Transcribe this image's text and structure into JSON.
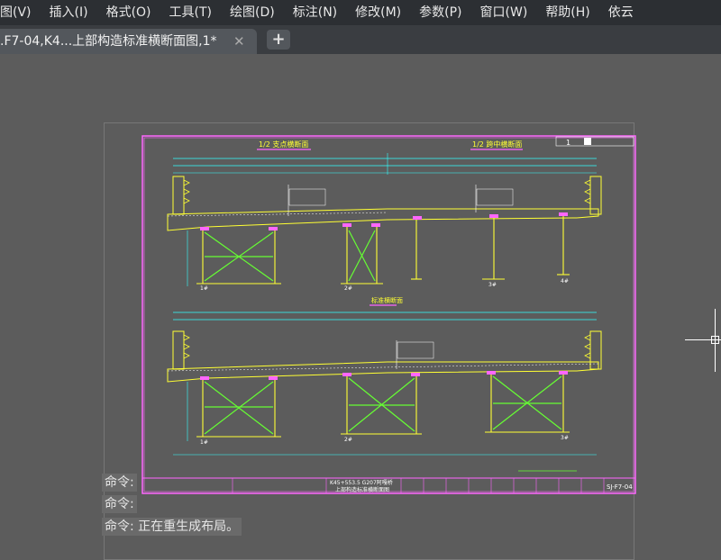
{
  "menu": {
    "items": [
      "图(V)",
      "插入(I)",
      "格式(O)",
      "工具(T)",
      "绘图(D)",
      "标注(N)",
      "修改(M)",
      "参数(P)",
      "窗口(W)",
      "帮助(H)",
      "依云"
    ]
  },
  "tabs": {
    "active_title": ".F7-04,K4...上部构造标准横断面图,1*",
    "close_glyph": "✕",
    "add_glyph": "+"
  },
  "drawing": {
    "top_left_title": "1/2 支点横断面",
    "top_right_title": "1/2 跨中横断面",
    "bottom_title": "标准横断面",
    "pier_labels_top": [
      "1#",
      "2#",
      "3#",
      "4#"
    ],
    "pier_labels_bottom": [
      "1#",
      "2#",
      "3#"
    ],
    "title_block_main": "K45+553.5 G207阿嘎桥",
    "title_block_sub": "上部构造标准横断面图",
    "drawing_number": "SJ-F7-04",
    "page_indicator": "1"
  },
  "command": {
    "line1_prompt": "命令:",
    "line2_prompt": "命令:",
    "line3_text": "命令: 正在重生成布局。"
  },
  "colors": {
    "border_magenta": "#ff66ff",
    "structure_yellow": "#ffff33",
    "dimension_cyan": "#33ffff",
    "cross_brace_green": "#66ff33",
    "text_white": "#ffffff",
    "background": "#5c5c5c"
  }
}
